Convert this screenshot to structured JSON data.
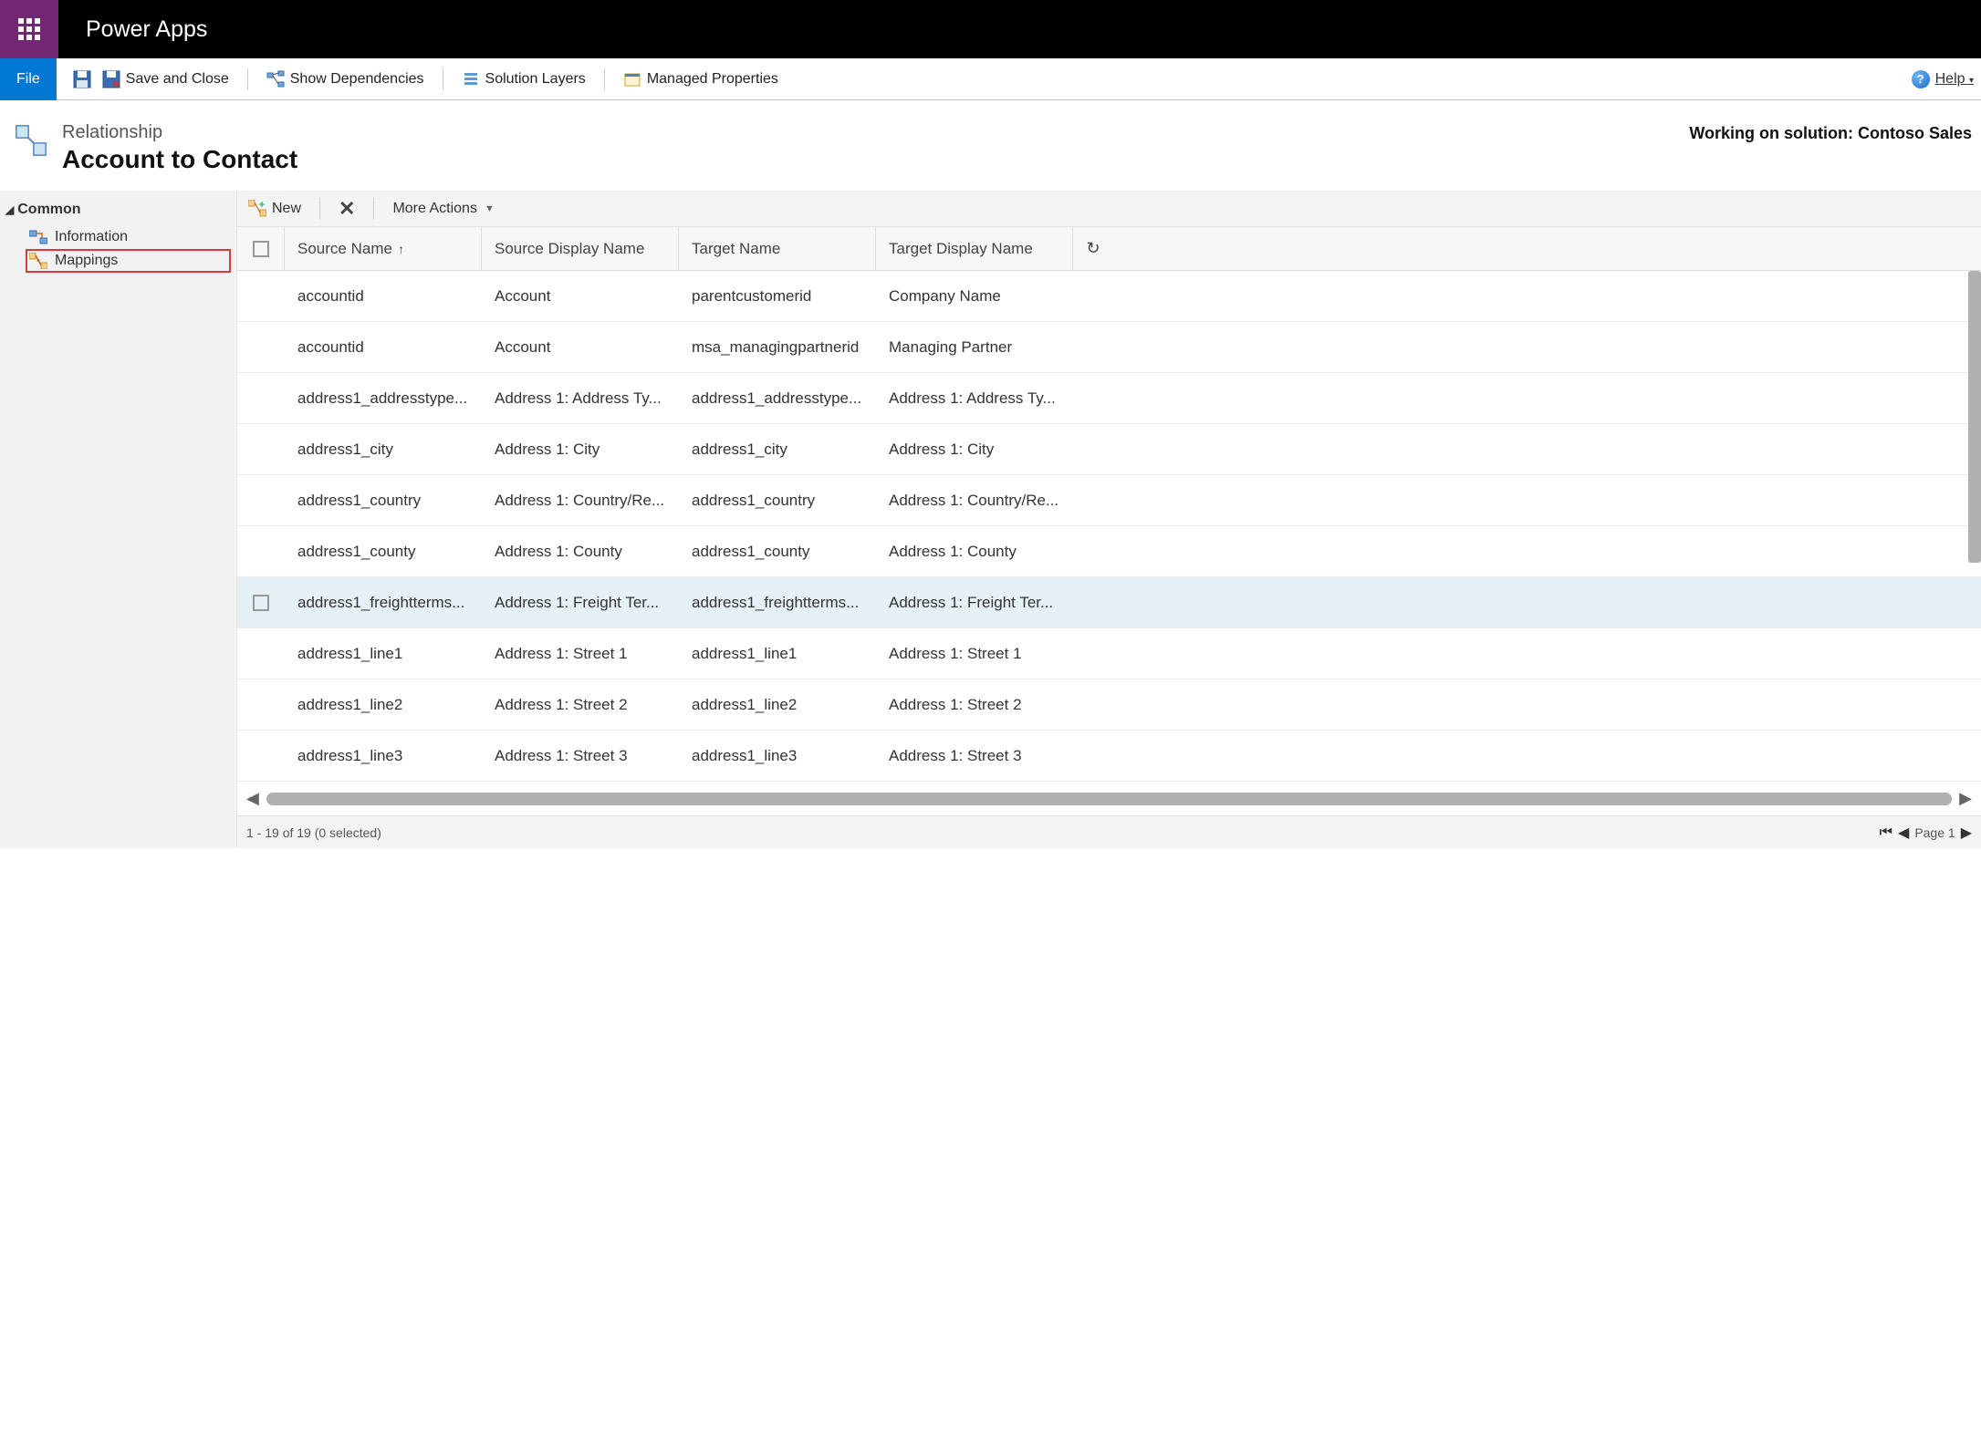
{
  "header": {
    "appTitle": "Power Apps"
  },
  "ribbon": {
    "file": "File",
    "saveClose": "Save and Close",
    "showDeps": "Show Dependencies",
    "solutionLayers": "Solution Layers",
    "managedProps": "Managed Properties",
    "help": "Help"
  },
  "page": {
    "breadcrumb": "Relationship",
    "title": "Account to Contact",
    "solutionPrefix": "Working on solution: ",
    "solutionName": "Contoso Sales"
  },
  "sidebar": {
    "root": "Common",
    "items": [
      {
        "label": "Information"
      },
      {
        "label": "Mappings"
      }
    ]
  },
  "subtoolbar": {
    "new": "New",
    "moreActions": "More Actions"
  },
  "grid": {
    "columns": {
      "sourceName": "Source Name",
      "sourceDisplay": "Source Display Name",
      "targetName": "Target Name",
      "targetDisplay": "Target Display Name"
    },
    "rows": [
      {
        "sn": "accountid",
        "sd": "Account",
        "tn": "parentcustomerid",
        "td": "Company Name"
      },
      {
        "sn": "accountid",
        "sd": "Account",
        "tn": "msa_managingpartnerid",
        "td": "Managing Partner"
      },
      {
        "sn": "address1_addresstype...",
        "sd": "Address 1: Address Ty...",
        "tn": "address1_addresstype...",
        "td": "Address 1: Address Ty..."
      },
      {
        "sn": "address1_city",
        "sd": "Address 1: City",
        "tn": "address1_city",
        "td": "Address 1: City"
      },
      {
        "sn": "address1_country",
        "sd": "Address 1: Country/Re...",
        "tn": "address1_country",
        "td": "Address 1: Country/Re..."
      },
      {
        "sn": "address1_county",
        "sd": "Address 1: County",
        "tn": "address1_county",
        "td": "Address 1: County"
      },
      {
        "sn": "address1_freightterms...",
        "sd": "Address 1: Freight Ter...",
        "tn": "address1_freightterms...",
        "td": "Address 1: Freight Ter..."
      },
      {
        "sn": "address1_line1",
        "sd": "Address 1: Street 1",
        "tn": "address1_line1",
        "td": "Address 1: Street 1"
      },
      {
        "sn": "address1_line2",
        "sd": "Address 1: Street 2",
        "tn": "address1_line2",
        "td": "Address 1: Street 2"
      },
      {
        "sn": "address1_line3",
        "sd": "Address 1: Street 3",
        "tn": "address1_line3",
        "td": "Address 1: Street 3"
      }
    ],
    "selectedIndex": 6
  },
  "status": {
    "count": "1 - 19 of 19 (0 selected)",
    "pageLabel": "Page 1"
  }
}
